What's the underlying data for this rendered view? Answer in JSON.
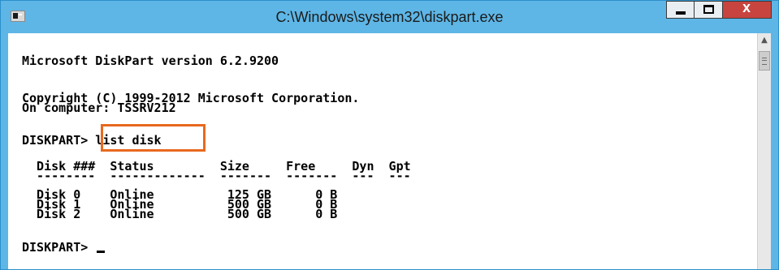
{
  "window": {
    "title": "C:\\Windows\\system32\\diskpart.exe",
    "close_label": "X",
    "colors": {
      "titlebar": "#5eb6e6",
      "close": "#c8453f",
      "highlight": "#e8691f"
    }
  },
  "console": {
    "lines": [
      "Microsoft DiskPart version 6.2.9200",
      "Copyright (C) 1999-2012 Microsoft Corporation.",
      "On computer: TSSRV212",
      "DISKPART> list disk",
      "  Disk ###  Status         Size     Free     Dyn  Gpt",
      "  --------  -------------  -------  -------  ---  ---",
      "  Disk 0    Online          125 GB      0 B",
      "  Disk 1    Online          500 GB      0 B",
      "  Disk 2    Online          500 GB      0 B",
      "DISKPART> "
    ],
    "highlighted_command": "list disk"
  },
  "icons": {
    "app": "console-app-icon",
    "minimize": "minimize-icon",
    "maximize": "maximize-icon",
    "close": "close-icon",
    "scroll_up": "scroll-up-arrow-icon",
    "scroll_thumb": "scroll-thumb-grip-icon"
  }
}
